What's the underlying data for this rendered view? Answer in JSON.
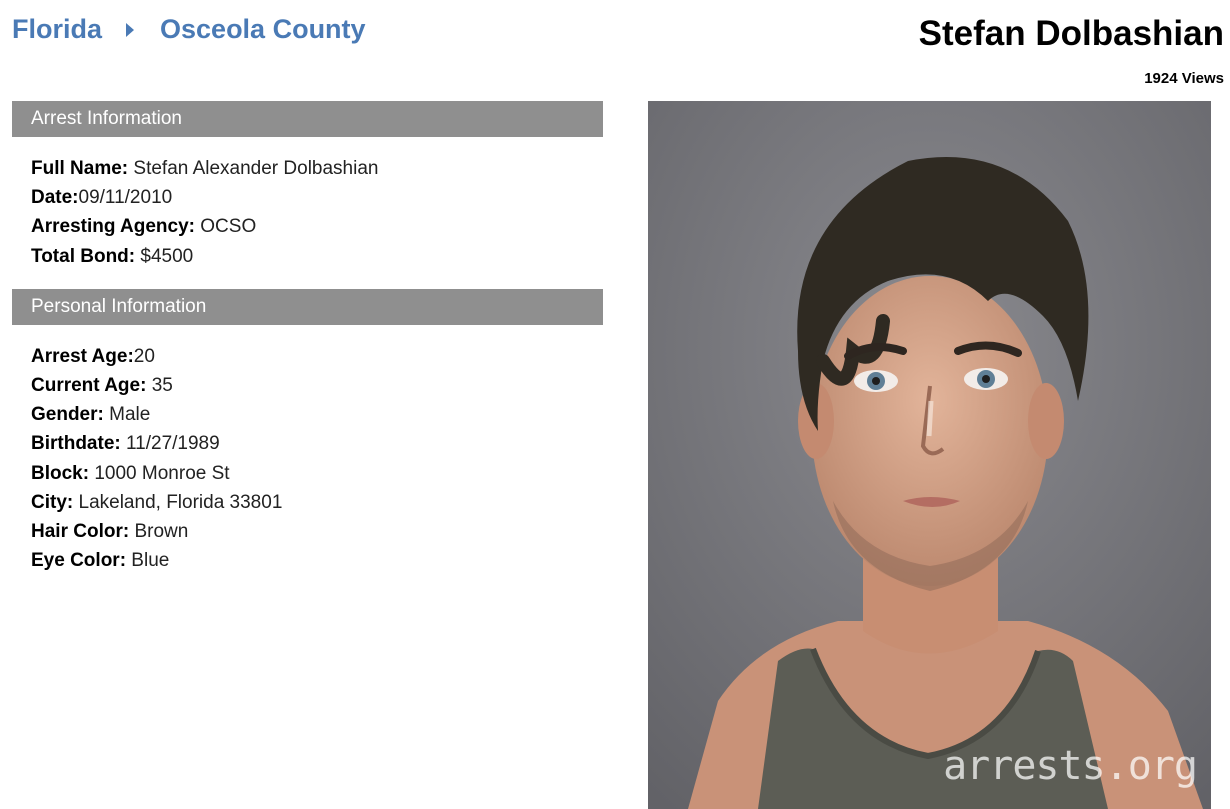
{
  "breadcrumb": {
    "state": "Florida",
    "county": "Osceola County"
  },
  "person": {
    "name": "Stefan Dolbashian",
    "views": "1924 Views"
  },
  "arrest_info": {
    "header": "Arrest Information",
    "fields": [
      {
        "label": "Full Name:",
        "value": " Stefan Alexander Dolbashian"
      },
      {
        "label": "Date:",
        "value": "09/11/2010"
      },
      {
        "label": "Arresting Agency:",
        "value": " OCSO"
      },
      {
        "label": "Total Bond:",
        "value": " $4500"
      }
    ]
  },
  "personal_info": {
    "header": "Personal Information",
    "fields": [
      {
        "label": "Arrest Age:",
        "value": "20"
      },
      {
        "label": "Current Age:",
        "value": " 35"
      },
      {
        "label": "Gender:",
        "value": " Male"
      },
      {
        "label": "Birthdate:",
        "value": " 11/27/1989"
      },
      {
        "label": "Block:",
        "value": " 1000 Monroe St"
      },
      {
        "label": "City:",
        "value": " Lakeland, Florida 33801"
      },
      {
        "label": "Hair Color:",
        "value": " Brown"
      },
      {
        "label": "Eye Color:",
        "value": " Blue"
      }
    ]
  },
  "photo": {
    "watermark": "arrests.org"
  },
  "icons": {
    "breadcrumb_separator": "caret-right-icon"
  },
  "colors": {
    "link": "#4a7ab5",
    "section_header_bg": "#8f8f8f"
  }
}
